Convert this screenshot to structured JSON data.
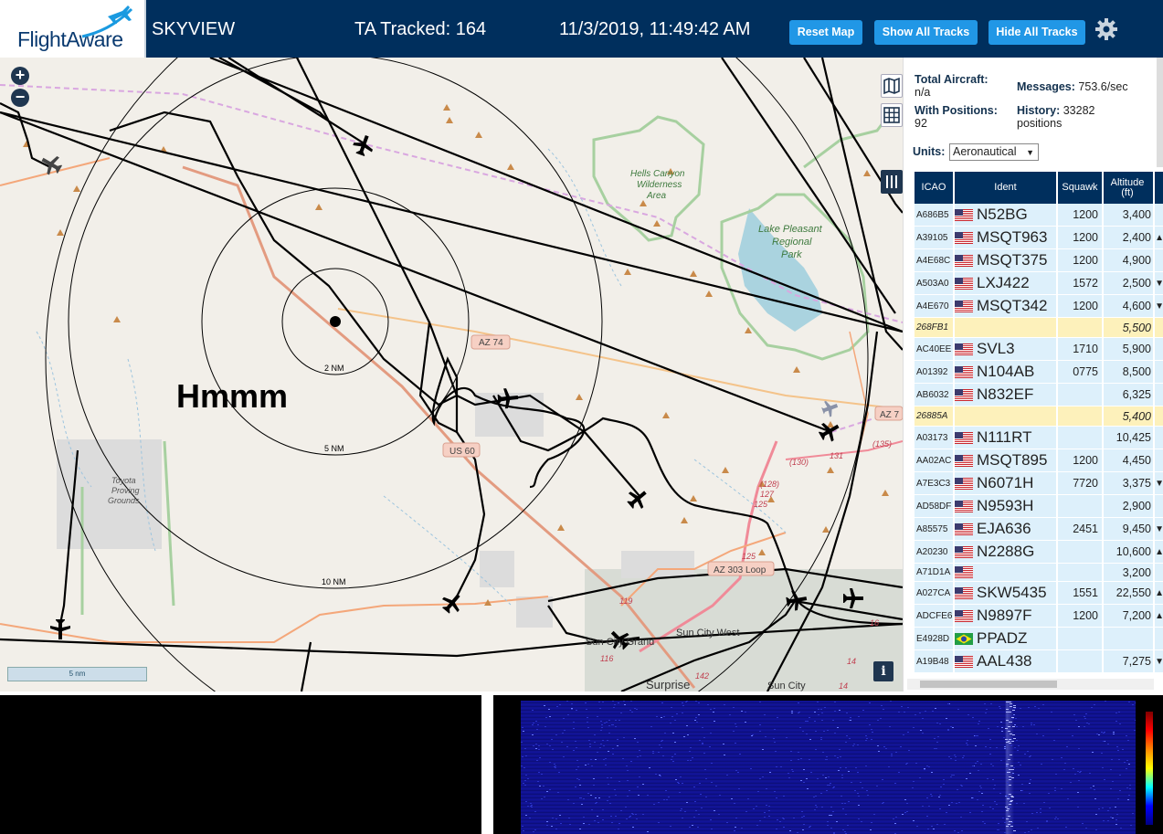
{
  "header": {
    "logo_text": "FlightAware",
    "app_title": "SKYVIEW",
    "tracked": "TA Tracked: 164",
    "datetime": "11/3/2019, 11:49:42 AM",
    "buttons": {
      "reset": "Reset Map",
      "show_all": "Show All Tracks",
      "hide_all": "Hide All Tracks"
    },
    "accent_color": "#2197e6",
    "bar_color": "#002f5d"
  },
  "map": {
    "zoom_in": "+",
    "zoom_out": "−",
    "annotation": "Hmmm",
    "scale_label": "5 nm",
    "info": "i",
    "ring_labels": [
      "2 NM",
      "5 NM",
      "10 NM"
    ],
    "place_labels": {
      "hells_canyon": [
        "Hells Canyon",
        "Wilderness",
        "Area"
      ],
      "lake_pleasant": [
        "Lake Pleasant",
        "Regional",
        "Park"
      ],
      "toyota": [
        "Toyota",
        "Proving",
        "Grounds"
      ],
      "sun_city_grand": "Sun City Grand",
      "sun_city_west": "Sun City West",
      "sun_city": "Sun City",
      "surprise": "Surprise"
    },
    "road_labels": {
      "az74": "AZ 74",
      "us60": "US 60",
      "az303": "AZ 303 Loop",
      "az74b": "AZ 7"
    },
    "route_numbers": [
      "(135)",
      "131",
      "(130)",
      "(128)",
      "127",
      "125",
      "125",
      "119",
      "116",
      "16",
      "14",
      "14",
      "142"
    ]
  },
  "sidebar": {
    "total_aircraft_label": "Total Aircraft:",
    "total_aircraft_value": "n/a",
    "with_positions_label": "With Positions:",
    "with_positions_value": "92",
    "messages_label": "Messages:",
    "messages_value": "753.6/sec",
    "history_label": "History:",
    "history_value": "33282",
    "history_unit": "positions",
    "units_label": "Units:",
    "units_value": "Aeronautical",
    "columns": [
      "ICAO",
      "Ident",
      "Squawk",
      "Altitude",
      "(ft)"
    ],
    "rows": [
      {
        "icao": "A686B5",
        "flag": "us",
        "ident": "N52BG",
        "squawk": "1200",
        "alt": "3,400",
        "trend": ""
      },
      {
        "icao": "A39105",
        "flag": "us",
        "ident": "MSQT963",
        "squawk": "1200",
        "alt": "2,400",
        "trend": "▲"
      },
      {
        "icao": "A4E68C",
        "flag": "us",
        "ident": "MSQT375",
        "squawk": "1200",
        "alt": "4,900",
        "trend": ""
      },
      {
        "icao": "A503A0",
        "flag": "us",
        "ident": "LXJ422",
        "squawk": "1572",
        "alt": "2,500",
        "trend": "▼"
      },
      {
        "icao": "A4E670",
        "flag": "us",
        "ident": "MSQT342",
        "squawk": "1200",
        "alt": "4,600",
        "trend": "▼"
      },
      {
        "icao": "268FB1",
        "flag": "",
        "ident": "",
        "squawk": "",
        "alt": "5,500",
        "trend": "",
        "highlight": true
      },
      {
        "icao": "AC40EE",
        "flag": "us",
        "ident": "SVL3",
        "squawk": "1710",
        "alt": "5,900",
        "trend": ""
      },
      {
        "icao": "A01392",
        "flag": "us",
        "ident": "N104AB",
        "squawk": "0775",
        "alt": "8,500",
        "trend": ""
      },
      {
        "icao": "AB6032",
        "flag": "us",
        "ident": "N832EF",
        "squawk": "",
        "alt": "6,325",
        "trend": ""
      },
      {
        "icao": "26885A",
        "flag": "",
        "ident": "",
        "squawk": "",
        "alt": "5,400",
        "trend": "",
        "highlight": true
      },
      {
        "icao": "A03173",
        "flag": "us",
        "ident": "N111RT",
        "squawk": "",
        "alt": "10,425",
        "trend": ""
      },
      {
        "icao": "AA02AC",
        "flag": "us",
        "ident": "MSQT895",
        "squawk": "1200",
        "alt": "4,450",
        "trend": ""
      },
      {
        "icao": "A7E3C3",
        "flag": "us",
        "ident": "N6071H",
        "squawk": "7720",
        "alt": "3,375",
        "trend": "▼"
      },
      {
        "icao": "AD58DF",
        "flag": "us",
        "ident": "N9593H",
        "squawk": "",
        "alt": "2,900",
        "trend": ""
      },
      {
        "icao": "A85575",
        "flag": "us",
        "ident": "EJA636",
        "squawk": "2451",
        "alt": "9,450",
        "trend": "▼"
      },
      {
        "icao": "A20230",
        "flag": "us",
        "ident": "N2288G",
        "squawk": "",
        "alt": "10,600",
        "trend": "▲"
      },
      {
        "icao": "A71D1A",
        "flag": "us",
        "ident": "",
        "squawk": "",
        "alt": "3,200",
        "trend": "",
        "short": true
      },
      {
        "icao": "A027CA",
        "flag": "us",
        "ident": "SKW5435",
        "squawk": "1551",
        "alt": "22,550",
        "trend": "▲"
      },
      {
        "icao": "ADCFE6",
        "flag": "us",
        "ident": "N9897F",
        "squawk": "1200",
        "alt": "7,200",
        "trend": "▲"
      },
      {
        "icao": "E4928D",
        "flag": "br",
        "ident": "PPADZ",
        "squawk": "",
        "alt": "",
        "trend": ""
      },
      {
        "icao": "A19B48",
        "flag": "us",
        "ident": "AAL438",
        "squawk": "",
        "alt": "7,275",
        "trend": "▼"
      }
    ]
  }
}
